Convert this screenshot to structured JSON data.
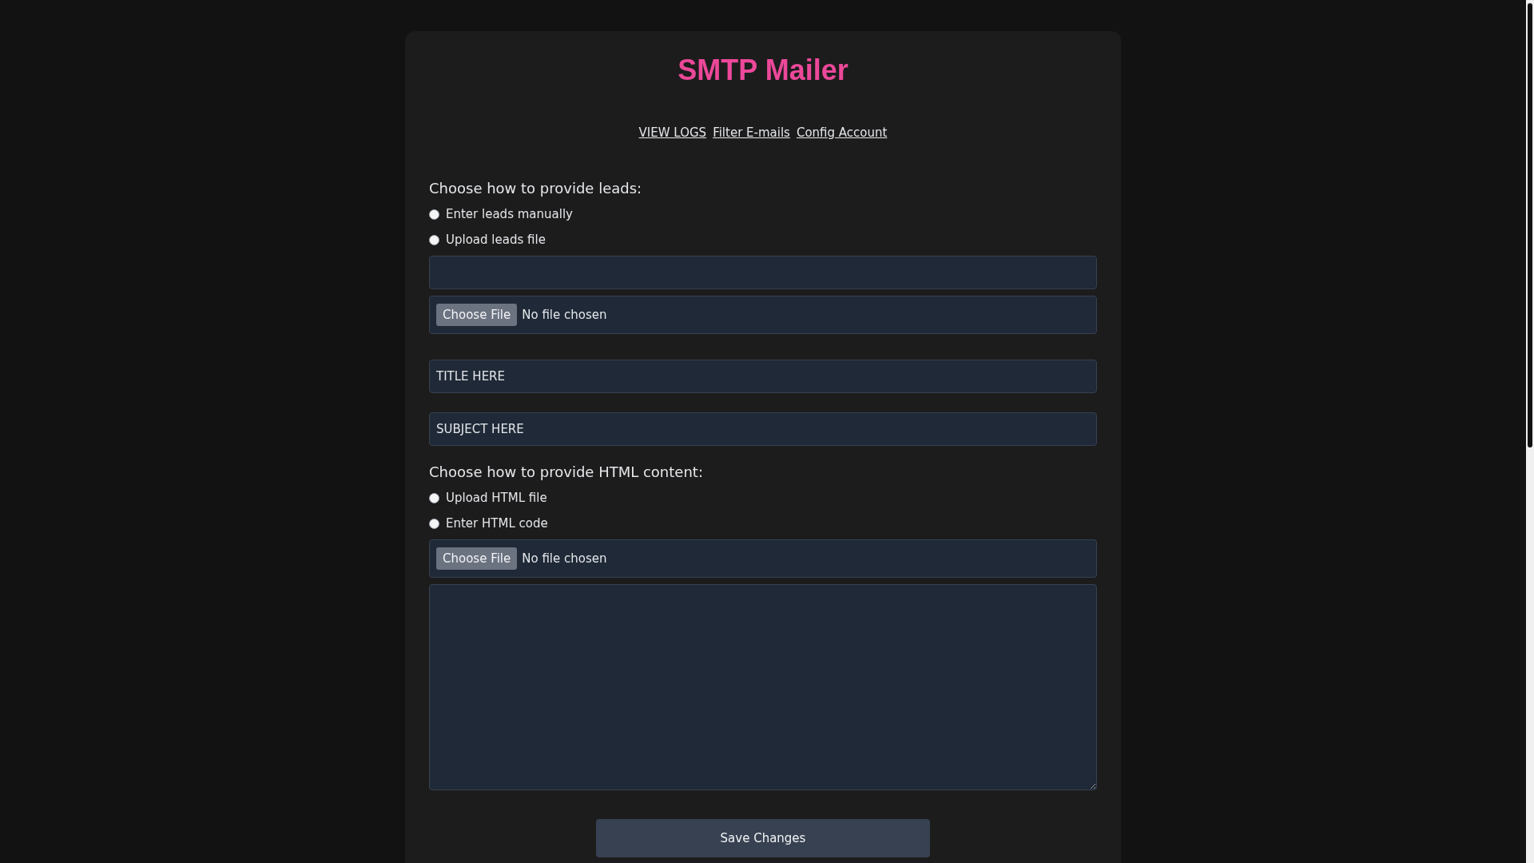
{
  "title": "SMTP Mailer",
  "nav_links": [
    "VIEW LOGS",
    "Filter E-mails",
    "Config Account"
  ],
  "leads": {
    "heading": "Choose how to provide leads:",
    "options": [
      {
        "label": "Enter leads manually",
        "selected": false
      },
      {
        "label": "Upload leads file",
        "selected": false
      }
    ],
    "file_input": {
      "button": "Choose File",
      "status": "No file chosen"
    }
  },
  "title_field": {
    "value": "TITLE HERE"
  },
  "subject_field": {
    "value": "SUBJECT HERE"
  },
  "html": {
    "heading": "Choose how to provide HTML content:",
    "options": [
      {
        "label": "Upload HTML file",
        "selected": false
      },
      {
        "label": "Enter HTML code",
        "selected": false
      }
    ],
    "file_input": {
      "button": "Choose File",
      "status": "No file chosen"
    }
  },
  "save_button": "Save Changes"
}
